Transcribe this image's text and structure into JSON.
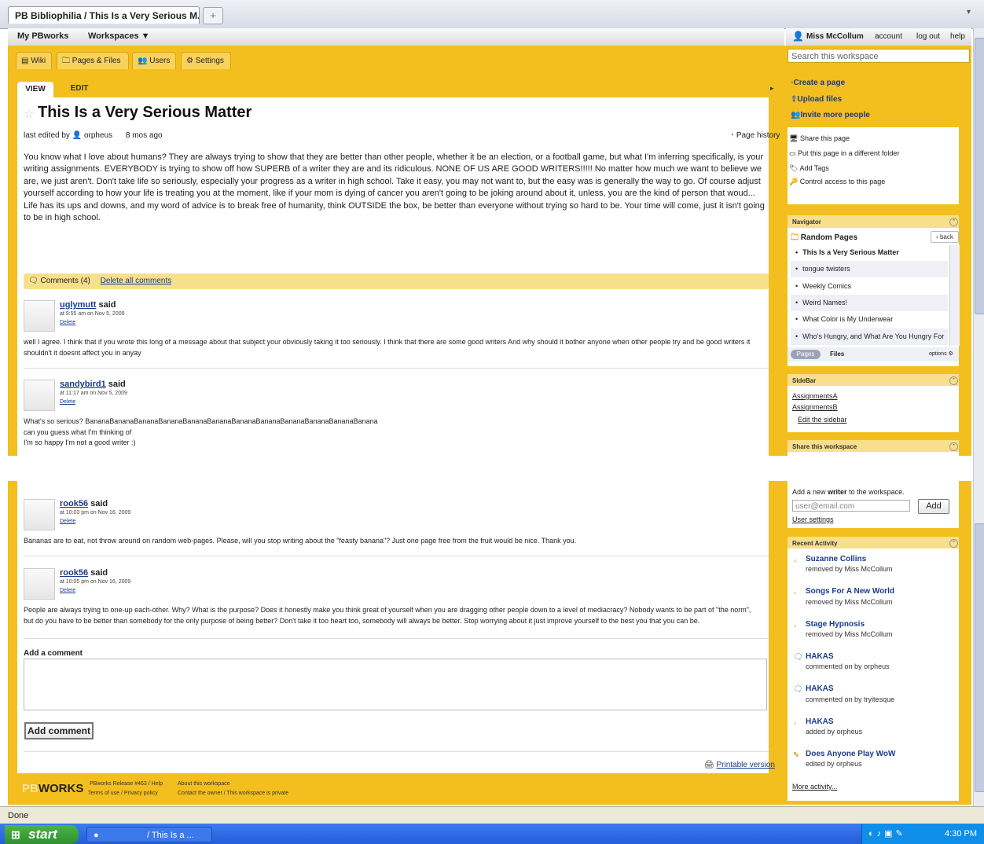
{
  "browser": {
    "tab_title": "PB Bibliophilia / This Is a Very Serious M...",
    "new_tab": "+",
    "tab_menu": "▾"
  },
  "topnav": {
    "my_pbworks": "My PBworks",
    "workspaces": "Workspaces ▼",
    "user": "Miss McCollum",
    "account": "account",
    "logout": "log out",
    "help": "help"
  },
  "search": {
    "placeholder": "Search this workspace"
  },
  "tabs": [
    {
      "label": "Wiki"
    },
    {
      "label": "Pages & Files"
    },
    {
      "label": "Users"
    },
    {
      "label": "Settings"
    }
  ],
  "page": {
    "view": "VIEW",
    "edit": "EDIT",
    "title": "This Is a Very Serious Matter",
    "last_edited_prefix": "last edited by",
    "last_edited_user": "orpheus",
    "last_edited_time": "8 mos ago",
    "history": "Page history",
    "body": "You know what I love about humans? They are always trying to show that they are better than other people, whether it be an election, or a football game, but what I'm inferring specifically, is your writing assignments. EVERYBODY is trying to show off how SUPERB of a writer they are and its ridiculous. NONE OF US ARE GOOD WRITERS!!!!! No matter how much we want to believe we are, we just aren't. Don't take life so seriously, especially your progress as a writer in high school. Take it easy, you may not want to, but the easy was is generally the way to go. Of course adjust yourself according to how your life is treating you at the moment, like if your mom is dying of cancer you aren't going to be joking around about it, unless, you are the kind of person that woud... Life has its ups and downs, and my word of advice is to break free of humanity, think OUTSIDE the box, be better than everyone without trying so hard to be. Your time will come, just it isn't going to be in high school."
  },
  "comments_bar": {
    "count_label": "Comments (4)",
    "delete_all": "Delete all comments"
  },
  "comments": [
    {
      "user": "uglymutt",
      "said": "said",
      "date": "at 9:55 am on Nov 5, 2009",
      "delete": "Delete",
      "text": "well I agree. I think that if you wrote this long of a message about that subject your obviously taking it too seriously. I think that there are some good writers And why should it bother anyone when other people try and be good writers it shouldn't it doesnt affect you in anyay"
    },
    {
      "user": "sandybird1",
      "said": "said",
      "date": "at 11:17 am on Nov 5, 2009",
      "delete": "Delete",
      "text": "What's so serious? BananaBananaBananaBananaBananaBananaBananaBananaBananaBananaBananaBanana\ncan you guess what I'm thinking of\nI'm so happy I'm not a good writer :)"
    },
    {
      "user": "rook56",
      "said": "said",
      "date": "at 10:03 pm on Nov 16, 2009",
      "delete": "Delete",
      "text": "Bananas are to eat, not throw around on random web-pages. Please, will you stop writing about the \"feasty banana\"? Just one page free from the fruit would be nice. Thank you."
    },
    {
      "user": "rook56",
      "said": "said",
      "date": "at 10:05 pm on Nov 16, 2009",
      "delete": "Delete",
      "text": "People are always trying to one-up each-other. Why? What is the purpose? Does it honestly make you think great of yourself when you are dragging other people down to a level of mediacracy? Nobody wants to be part of \"the norm\", but do you have to be better than somebody for the only purpose of being better? Don't take it too heart too, somebody will always be better. Stop worrying about it just improve yourself to the best you that you can be."
    }
  ],
  "add_comment": {
    "label": "Add a comment",
    "button": "Add comment"
  },
  "printable": "Printable version",
  "footer": {
    "logo_pb": "PB",
    "logo_works": "WORKS",
    "release": "PBworks Release #463 / Help",
    "terms": "Terms of use / Privacy policy",
    "about": "About this workspace",
    "contact": "Contact the owner / This workspace is private"
  },
  "sidebar": {
    "create_page": "Create a page",
    "upload_files": "Upload files",
    "invite_people": "Invite more people",
    "actions": [
      "Share this page",
      "Put this page in a different folder",
      "Add Tags",
      "Control access to this page"
    ],
    "navigator": {
      "title": "Navigator",
      "folder": "Random Pages",
      "back": "back",
      "items": [
        "This Is a Very Serious Matter",
        "tongue twisters",
        "Weekly Comics",
        "Weird Names!",
        "What Color is My Underwear",
        "Who's Hungry, and What Are You Hungry For"
      ],
      "pages": "Pages",
      "files": "Files",
      "options": "options"
    },
    "sidebar_box": {
      "title": "SideBar",
      "links": [
        "AssignmentsA",
        "AssignmentsB"
      ],
      "edit": "Edit the sidebar"
    },
    "share": {
      "title": "Share this workspace",
      "prompt_pre": "Add a new",
      "prompt_bold": "writer",
      "prompt_post": "to the workspace.",
      "placeholder": "user@email.com",
      "button": "Add",
      "user_settings": "User settings"
    },
    "recent": {
      "title": "Recent Activity",
      "items": [
        {
          "title": "Suzanne Collins",
          "action": "removed by",
          "user": "Miss McCollum"
        },
        {
          "title": "Songs For A New World",
          "action": "removed by",
          "user": "Miss McCollum"
        },
        {
          "title": "Stage Hypnosis",
          "action": "removed by",
          "user": "Miss McCollum"
        },
        {
          "title": "HAKAS",
          "action": "commented on by",
          "user": "orpheus"
        },
        {
          "title": "HAKAS",
          "action": "commented on by",
          "user": "tryitesque"
        },
        {
          "title": "HAKAS",
          "action": "added by",
          "user": "orpheus"
        },
        {
          "title": "Does Anyone Play WoW",
          "action": "edited by",
          "user": "orpheus"
        }
      ],
      "more": "More activity..."
    }
  },
  "statusbar": {
    "text": "Done"
  },
  "taskbar": {
    "start": "start",
    "window": "/ This Is a ...",
    "clock": "4:30 PM"
  },
  "colors": {
    "brand_orange": "#f3bf1e",
    "link_blue": "#1a3a8a"
  }
}
